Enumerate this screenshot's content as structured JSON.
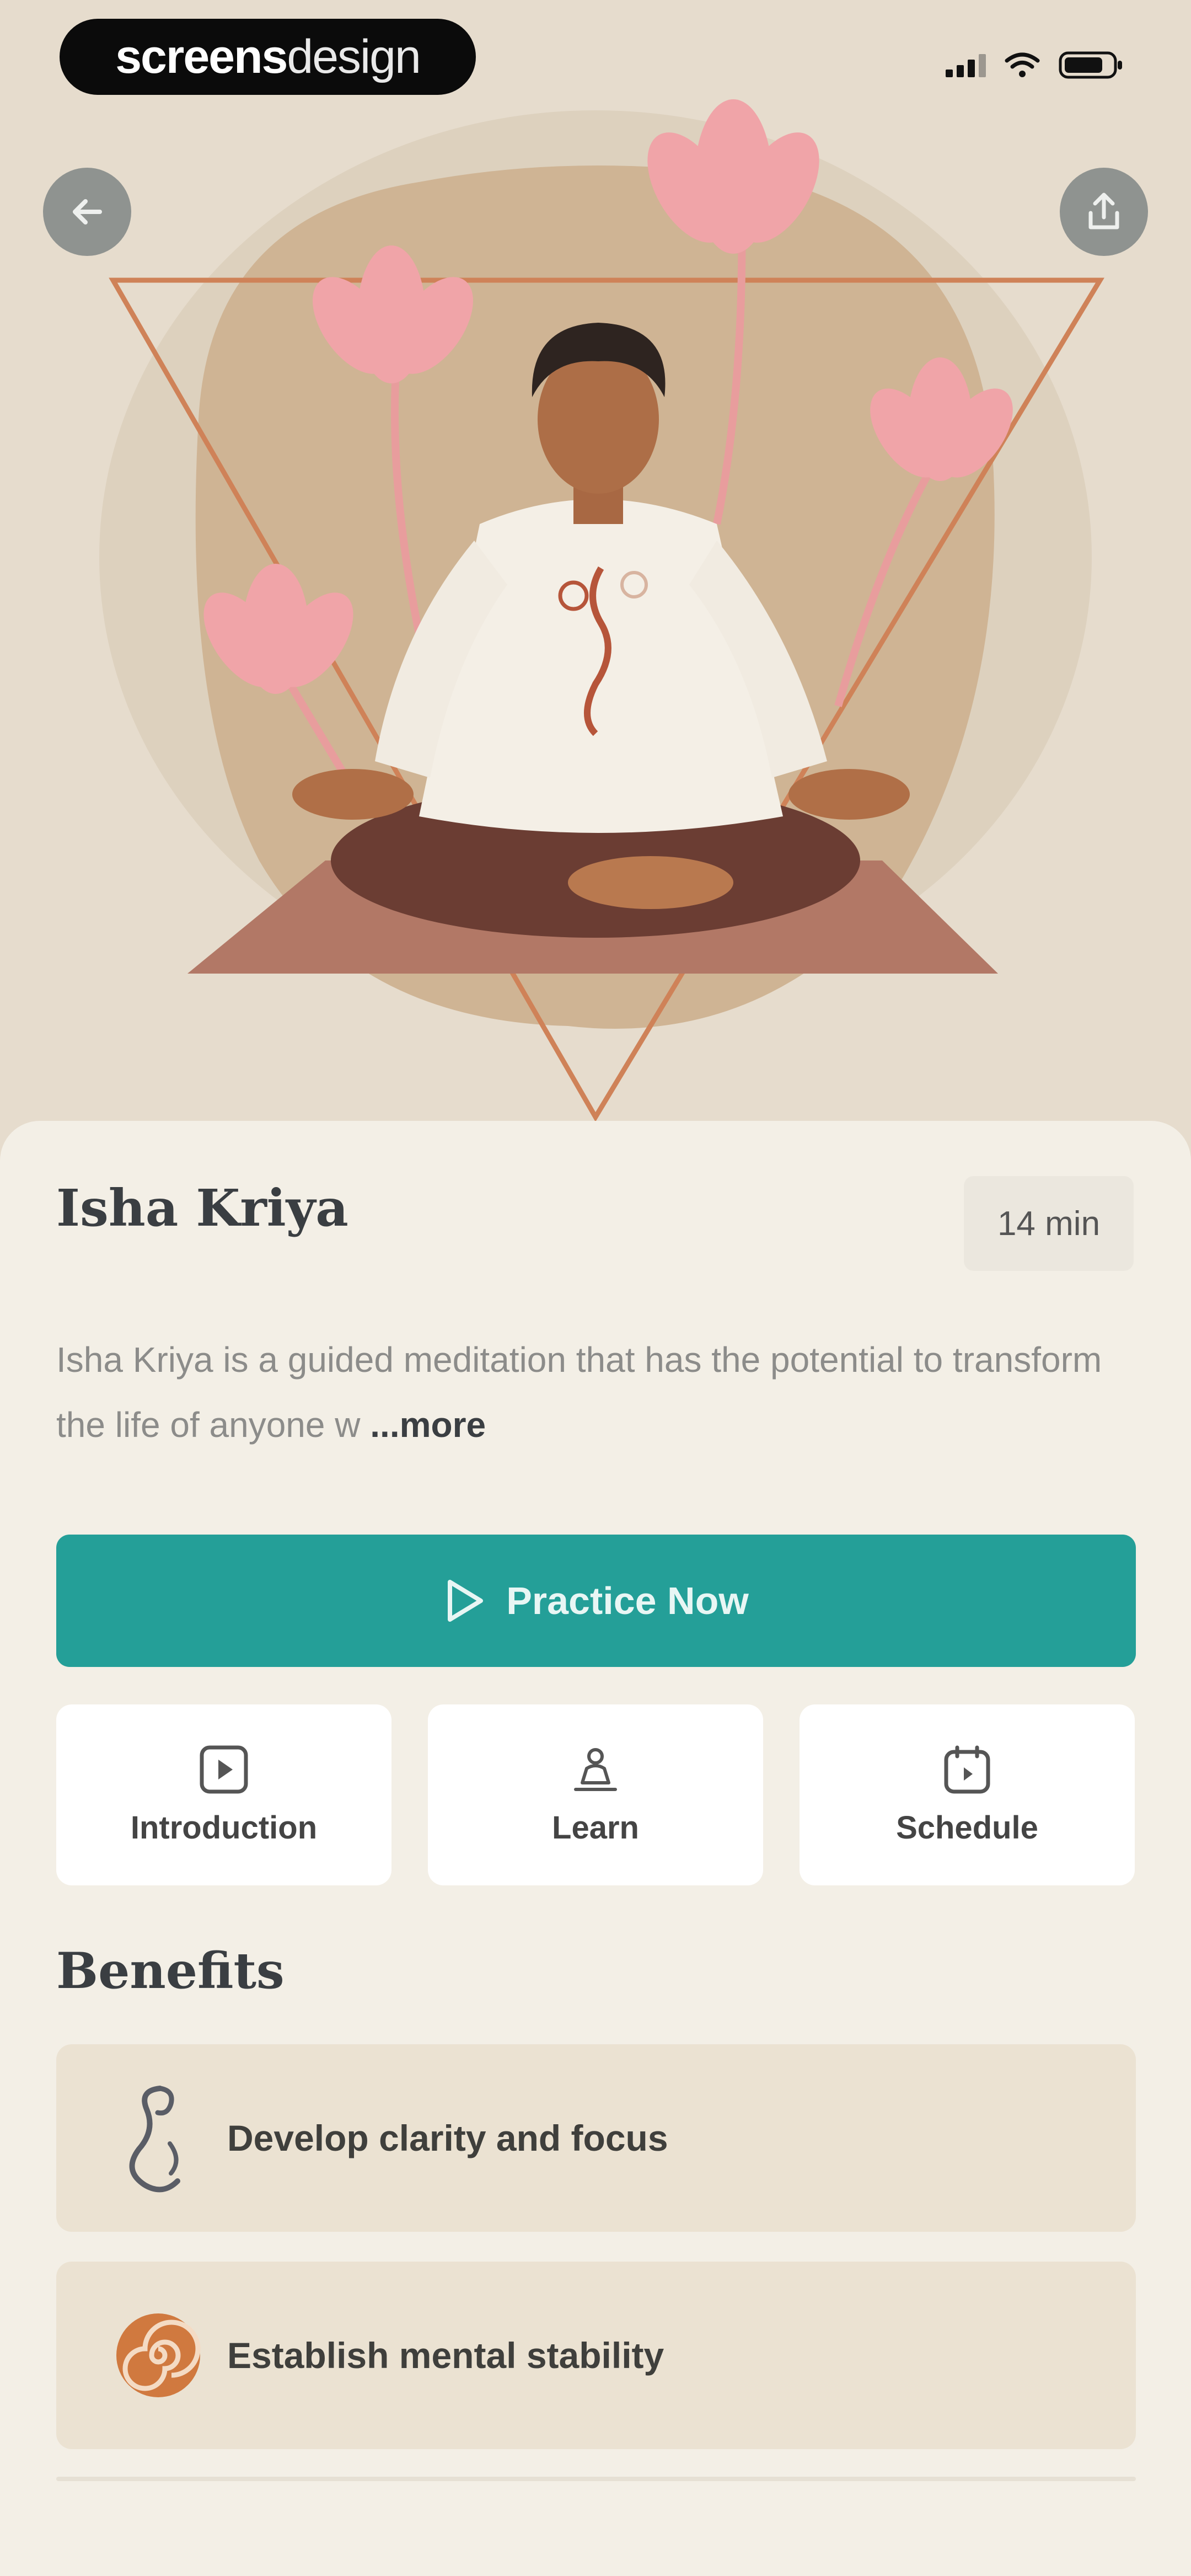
{
  "brand": {
    "bold": "screens",
    "light": "design"
  },
  "session": {
    "title": "Isha Kriya",
    "duration": "14 min",
    "description": "Isha Kriya is a guided meditation that has the potential to transform the life of anyone w",
    "more_label": "...more"
  },
  "actions": {
    "practice_label": "Practice Now",
    "tiles": [
      {
        "label": "Introduction",
        "icon": "play-square-icon"
      },
      {
        "label": "Learn",
        "icon": "meditation-icon"
      },
      {
        "label": "Schedule",
        "icon": "calendar-icon"
      }
    ]
  },
  "benefits": {
    "heading": "Benefits",
    "items": [
      {
        "label": "Develop clarity and focus",
        "icon": "serpent-icon"
      },
      {
        "label": "Establish mental stability",
        "icon": "spiral-icon"
      }
    ]
  },
  "colors": {
    "accent": "#249f98",
    "background": "#f3efe6",
    "hero": "#e6dccd"
  }
}
